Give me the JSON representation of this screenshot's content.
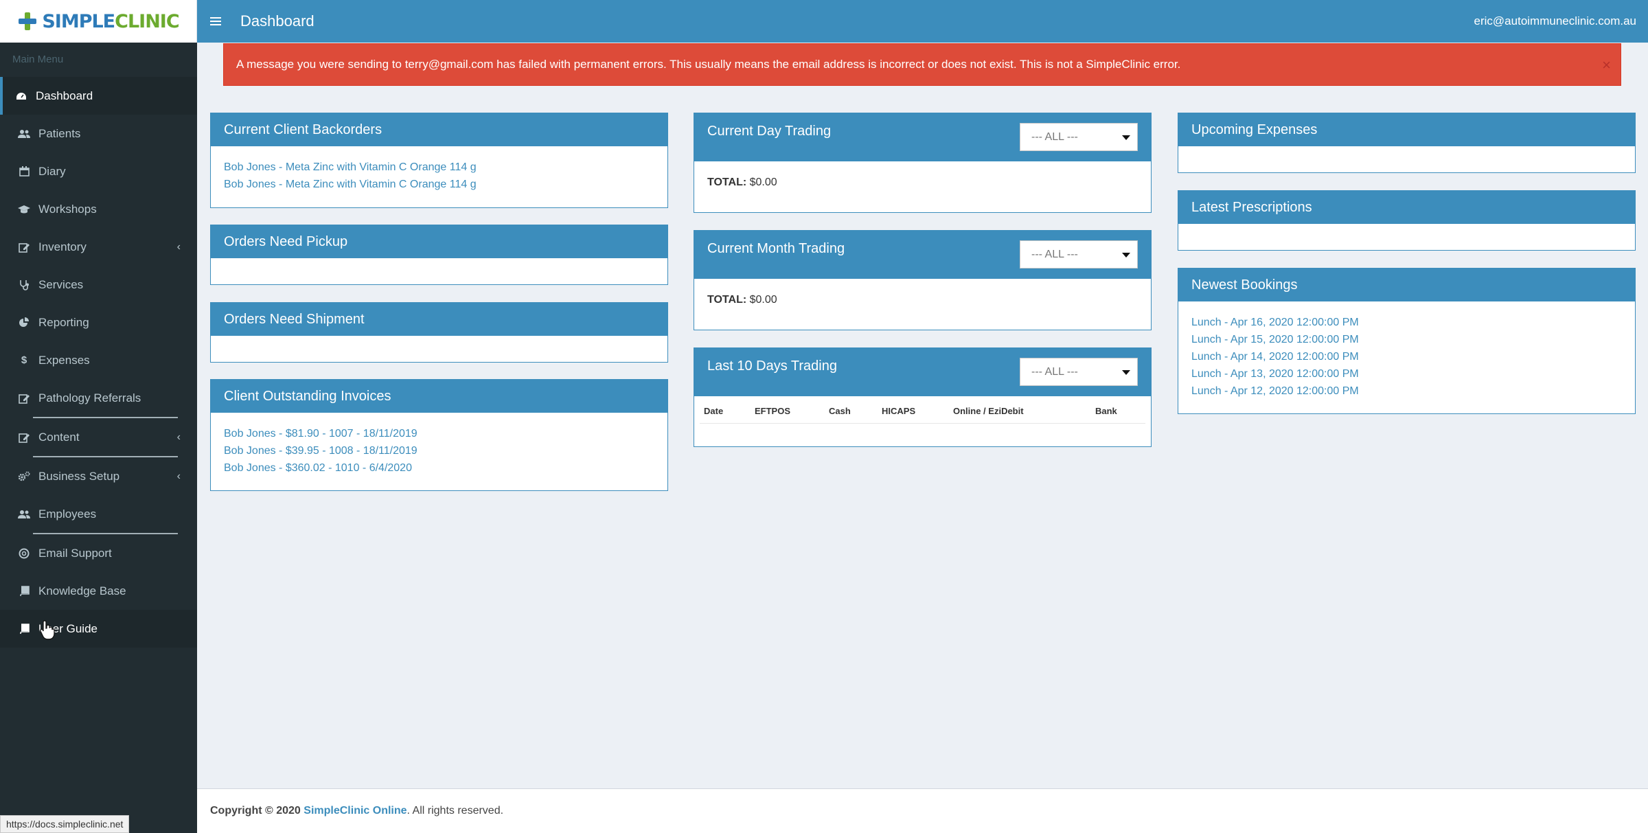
{
  "app": {
    "logo_text_a": "SIMPLE",
    "logo_text_b": "CLINIC"
  },
  "sidebar": {
    "header": "Main Menu",
    "items": [
      {
        "label": "Dashboard",
        "icon": "dashboard-icon"
      },
      {
        "label": "Patients",
        "icon": "users-icon"
      },
      {
        "label": "Diary",
        "icon": "calendar-icon"
      },
      {
        "label": "Workshops",
        "icon": "graduation-cap-icon"
      },
      {
        "label": "Inventory",
        "icon": "edit-icon"
      },
      {
        "label": "Services",
        "icon": "stethoscope-icon"
      },
      {
        "label": "Reporting",
        "icon": "pie-chart-icon"
      },
      {
        "label": "Expenses",
        "icon": "dollar-icon"
      },
      {
        "label": "Pathology Referrals",
        "icon": "edit-icon"
      },
      {
        "label": "Content",
        "icon": "edit-icon"
      },
      {
        "label": "Business Setup",
        "icon": "cogs-icon"
      },
      {
        "label": "Employees",
        "icon": "users-icon"
      },
      {
        "label": "Email Support",
        "icon": "lifebuoy-icon"
      },
      {
        "label": "Knowledge Base",
        "icon": "book-icon"
      },
      {
        "label": "User Guide",
        "icon": "book-icon"
      }
    ]
  },
  "status_url": "https://docs.simpleclinic.net",
  "topbar": {
    "title": "Dashboard",
    "user_email": "eric@autoimmuneclinic.com.au"
  },
  "alert": {
    "message": "A message you were sending to terry@gmail.com has failed with permanent errors. This usually means the email address is incorrect or does not exist. This is not a SimpleClinic error.",
    "close": "×"
  },
  "panels": {
    "backorders": {
      "title": "Current Client Backorders",
      "items": [
        "Bob Jones - Meta Zinc with Vitamin C Orange 114 g",
        "Bob Jones - Meta Zinc with Vitamin C Orange 114 g"
      ]
    },
    "pickup": {
      "title": "Orders Need Pickup"
    },
    "shipment": {
      "title": "Orders Need Shipment"
    },
    "invoices": {
      "title": "Client Outstanding Invoices",
      "items": [
        "Bob Jones - $81.90 - 1007 - 18/11/2019",
        "Bob Jones - $39.95 - 1008 - 18/11/2019",
        "Bob Jones - $360.02 - 1010 - 6/4/2020"
      ]
    },
    "day_trading": {
      "title": "Current Day Trading",
      "select": "--- ALL ---",
      "total_label": "TOTAL:",
      "total_value": "$0.00"
    },
    "month_trading": {
      "title": "Current Month Trading",
      "select": "--- ALL ---",
      "total_label": "TOTAL:",
      "total_value": "$0.00"
    },
    "ten_days": {
      "title": "Last 10 Days Trading",
      "select": "--- ALL ---",
      "columns": [
        "Date",
        "EFTPOS",
        "Cash",
        "HICAPS",
        "Online / EziDebit",
        "Bank"
      ]
    },
    "expenses": {
      "title": "Upcoming Expenses"
    },
    "prescriptions": {
      "title": "Latest Prescriptions"
    },
    "bookings": {
      "title": "Newest Bookings",
      "items": [
        "Lunch - Apr 16, 2020 12:00:00 PM",
        "Lunch - Apr 15, 2020 12:00:00 PM",
        "Lunch - Apr 14, 2020 12:00:00 PM",
        "Lunch - Apr 13, 2020 12:00:00 PM",
        "Lunch - Apr 12, 2020 12:00:00 PM"
      ]
    }
  },
  "footer": {
    "copyright": "Copyright © 2020",
    "brand": "SimpleClinic Online",
    "rights": ". All rights reserved."
  },
  "colors": {
    "primary": "#3c8dbc",
    "sidebar_bg": "#222d32",
    "alert": "#dd4b39"
  }
}
